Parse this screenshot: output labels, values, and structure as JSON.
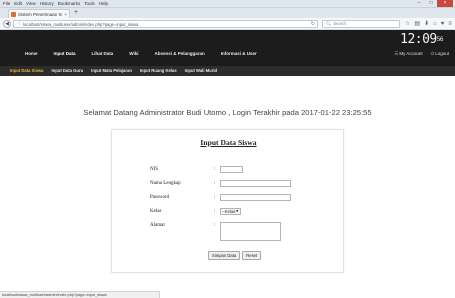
{
  "browser": {
    "menu": [
      "File",
      "Edit",
      "View",
      "History",
      "Bookmarks",
      "Tools",
      "Help"
    ],
    "tab": {
      "title": "Sistem Penerimaan Siswa ...",
      "close": "×"
    },
    "new_tab": "+",
    "url": "localhost/siswa_multiuser/admin/index.php?page=input_siswa",
    "search_placeholder": "Search",
    "search_icon": "magnifier-icon",
    "toolbar_icons": [
      "star-icon",
      "bookmarks-icon",
      "download-icon",
      "home-icon",
      "pocket-icon",
      "menu-icon"
    ],
    "window_controls": {
      "minimize": "–",
      "maximize": "□",
      "close": "×"
    }
  },
  "header": {
    "clock_hm": "12:09",
    "clock_sec": "56",
    "nav": [
      "Home",
      "Input Data",
      "Lihat Data",
      "Wiki",
      "Absensi & Pelanggaran",
      "Informasi & User"
    ],
    "active_nav": "Input Data",
    "my_account": "My Account",
    "logout": "Logout"
  },
  "subnav": {
    "items": [
      "Input Data Siswa",
      "Input Data Guru",
      "Input Mata Pelajaran",
      "Input Ruang Kelas",
      "Input Wali Murid"
    ],
    "active": "Input Data Siswa"
  },
  "welcome": "Selamat Datang Administrator Budi Utomo , Login Terakhir pada 2017-01-22 23:25:55",
  "form": {
    "title": "Input Data Siswa",
    "fields": {
      "nis": {
        "label": "NIS",
        "value": ""
      },
      "nama": {
        "label": "Nama Lengkap",
        "value": ""
      },
      "password": {
        "label": "Password",
        "value": ""
      },
      "kelas": {
        "label": "Kelas",
        "selected": "--Kelas--"
      },
      "alamat": {
        "label": "Alamat",
        "value": ""
      }
    },
    "colon": ":",
    "submit_label": "Simpan Data",
    "reset_label": "Reset"
  },
  "statusbar": "localhost/siswa_multiuser/admin/index.php?page=input_siswa"
}
